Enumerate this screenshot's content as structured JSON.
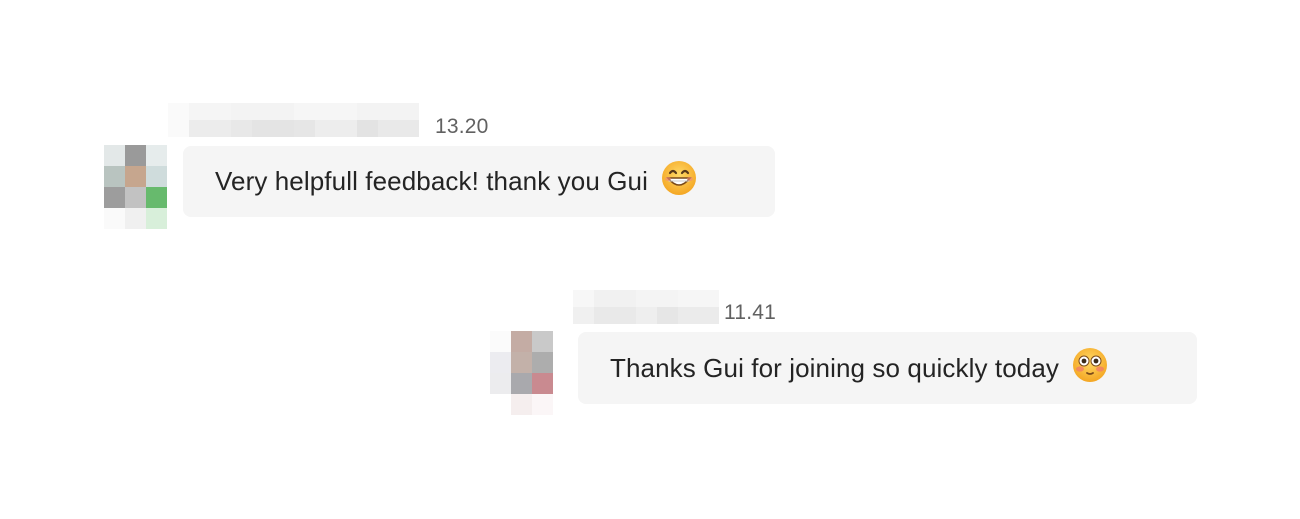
{
  "messages": [
    {
      "time": "13.20",
      "text": "Very helpfull feedback! thank you Gui",
      "emoji": "grinning-face-icon"
    },
    {
      "time": "11.41",
      "text": "Thanks Gui for joining so quickly today",
      "emoji": "flushed-face-icon"
    }
  ],
  "colors": {
    "bubble_bg": "#f5f5f5",
    "timestamp": "#616161",
    "text": "#242424"
  }
}
